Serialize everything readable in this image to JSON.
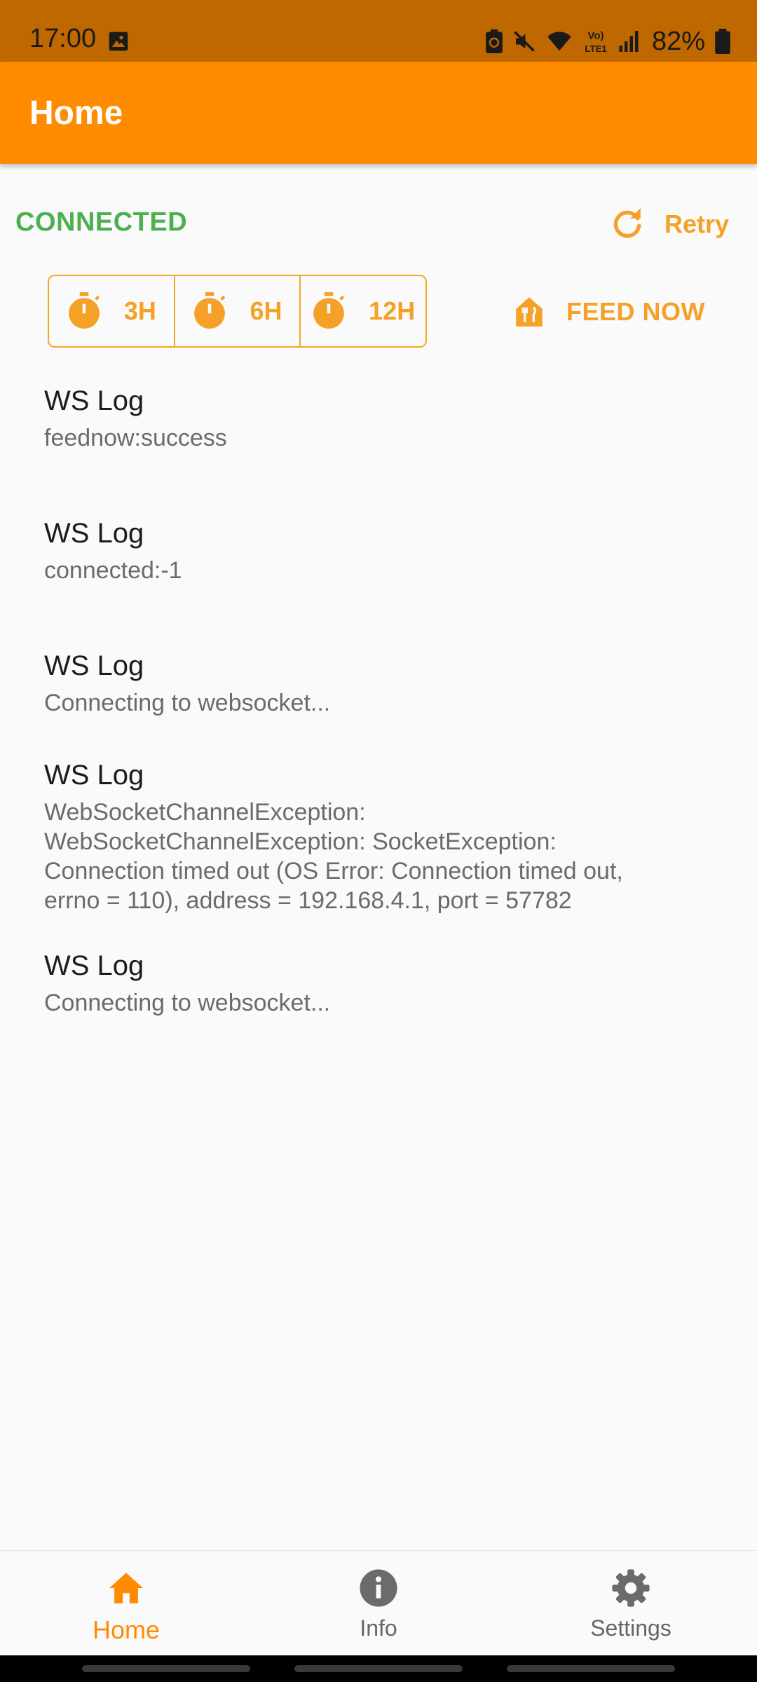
{
  "status_bar": {
    "time": "17:00",
    "battery_percent": "82%",
    "icons": [
      "gallery-icon",
      "battery-saver-icon",
      "mute-icon",
      "wifi-icon",
      "volte-icon",
      "signal-icon",
      "battery-icon"
    ]
  },
  "app_bar": {
    "title": "Home"
  },
  "connection": {
    "status": "CONNECTED",
    "status_color": "#4caf50",
    "retry_label": "Retry"
  },
  "timers": [
    {
      "label": "3H",
      "icon": "timer-icon"
    },
    {
      "label": "6H",
      "icon": "timer-icon"
    },
    {
      "label": "12H",
      "icon": "timer-icon"
    }
  ],
  "feed": {
    "label": "FEED NOW",
    "icon": "restaurant-icon"
  },
  "logs": [
    {
      "title": "WS Log",
      "text": "feednow:success"
    },
    {
      "title": "WS Log",
      "text": "connected:-1"
    },
    {
      "title": "WS Log",
      "text": "Connecting to websocket..."
    },
    {
      "title": "WS Log",
      "text": "WebSocketChannelException:\nWebSocketChannelException: SocketException:\nConnection timed out (OS Error: Connection timed out,\nerrno = 110), address = 192.168.4.1, port = 57782"
    },
    {
      "title": "WS Log",
      "text": "Connecting to websocket..."
    }
  ],
  "bottom_nav": {
    "items": [
      {
        "label": "Home",
        "icon": "home-icon",
        "active": true
      },
      {
        "label": "Info",
        "icon": "info-icon",
        "active": false
      },
      {
        "label": "Settings",
        "icon": "gear-icon",
        "active": false
      }
    ]
  },
  "colors": {
    "accent": "#ff8c00",
    "status_bar": "#c06800",
    "button_text": "#f5a026",
    "connected": "#4caf50"
  }
}
